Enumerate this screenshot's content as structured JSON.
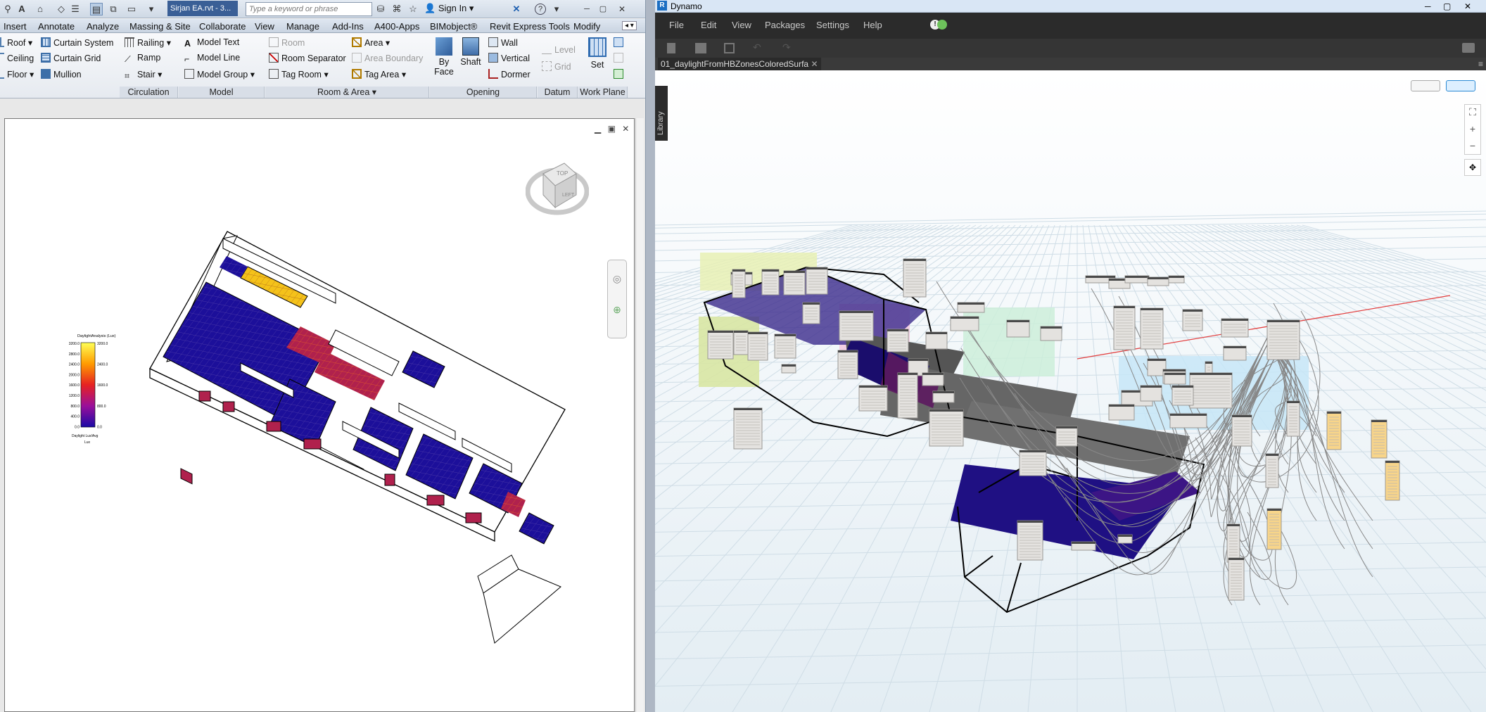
{
  "revit": {
    "qat_chip": "Sirjan EA.rvt - 3...",
    "search_placeholder": "Type a keyword or phrase",
    "signin": "Sign In",
    "tabs": [
      "Insert",
      "Annotate",
      "Analyze",
      "Massing & Site",
      "Collaborate",
      "View",
      "Manage",
      "Add-Ins",
      "A400-Apps",
      "BIMobject®",
      "Revit Express Tools",
      "Modify"
    ],
    "ribbon": {
      "build_col": [
        "Roof",
        "Ceiling",
        "Floor"
      ],
      "curtain_col": [
        "Curtain System",
        "Curtain Grid",
        "Mullion"
      ],
      "circulation_col": [
        "Railing",
        "Ramp",
        "Stair"
      ],
      "model_col": [
        "Model Text",
        "Model Line",
        "Model Group"
      ],
      "room_col": [
        "Room",
        "Room Separator",
        "Tag Room"
      ],
      "area_col": [
        "Area",
        "Area Boundary",
        "Tag Area"
      ],
      "opening_big": [
        "By Face",
        "Shaft"
      ],
      "opening_col": [
        "Wall",
        "Vertical",
        "Dormer"
      ],
      "datum_col": [
        "Level",
        "Grid"
      ],
      "workplane_set": "Set",
      "panels": [
        "Circulation",
        "Model",
        "Room & Area",
        "Opening",
        "Datum",
        "Work Plane"
      ]
    },
    "viewcube": {
      "top": "TOP",
      "left": "LEFT"
    },
    "legend": {
      "title": "DaylightAnalysis (Lux)",
      "left_ticks": [
        "3200.0",
        "2800.0",
        "2400.0",
        "2000.0",
        "1600.0",
        "1200.0",
        "800.0",
        "400.0",
        "0.0"
      ],
      "right_ticks": [
        "3200.0",
        "2400.0",
        "1600.0",
        "800.0",
        "0.0"
      ],
      "footer1": "Daylight Lux/Avg",
      "footer2": "Lux"
    }
  },
  "dynamo": {
    "title": "Dynamo",
    "menu": [
      "File",
      "Edit",
      "View",
      "Packages",
      "Settings",
      "Help"
    ],
    "tab": "01_daylightFromHBZonesColoredSurfa",
    "library": "Library"
  }
}
